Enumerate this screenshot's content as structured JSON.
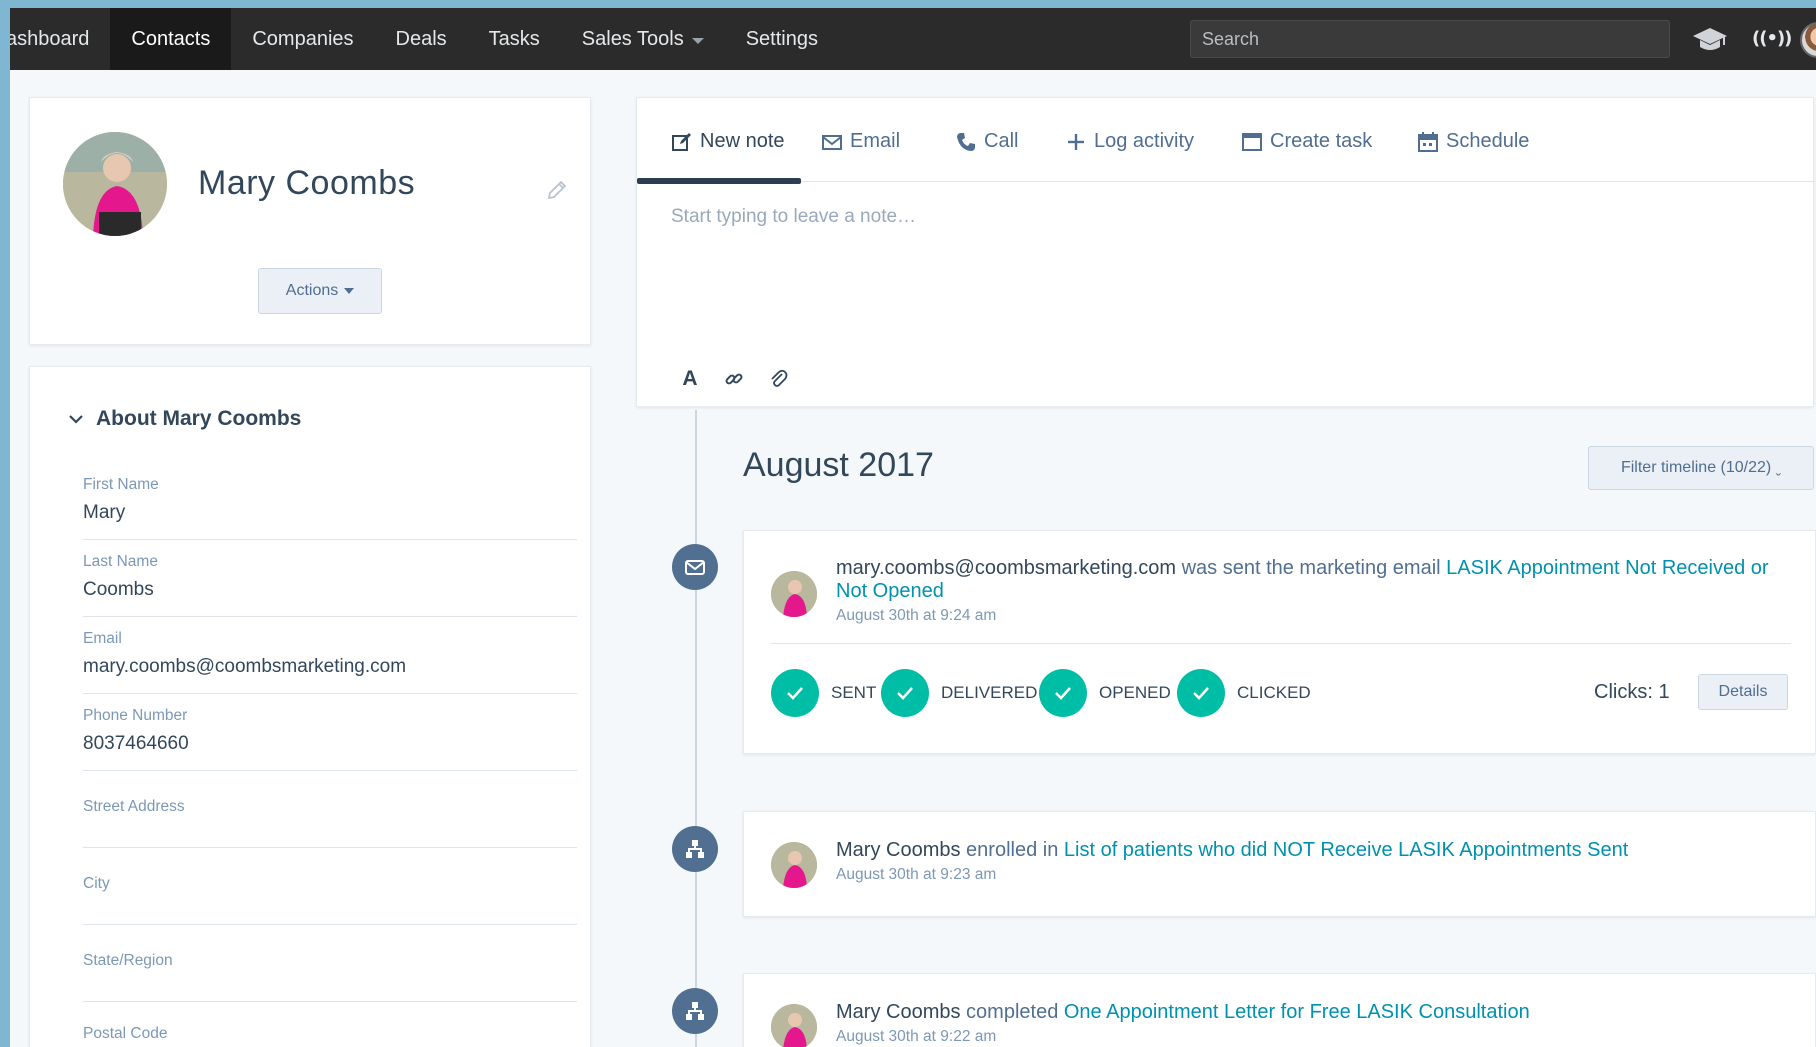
{
  "nav": {
    "items": [
      {
        "label": "ashboard",
        "active": false
      },
      {
        "label": "Contacts",
        "active": true
      },
      {
        "label": "Companies",
        "active": false
      },
      {
        "label": "Deals",
        "active": false
      },
      {
        "label": "Tasks",
        "active": false
      },
      {
        "label": "Sales Tools",
        "active": false,
        "dropdown": true
      },
      {
        "label": "Settings",
        "active": false
      }
    ],
    "search_placeholder": "Search",
    "icons": [
      "graduation-cap-icon",
      "broadcast-icon",
      "user-avatar"
    ],
    "broadcast_glyph": "((•))"
  },
  "profile": {
    "name": "Mary Coombs",
    "actions_label": "Actions"
  },
  "about": {
    "title": "About Mary Coombs",
    "fields": [
      {
        "label": "First Name",
        "value": "Mary"
      },
      {
        "label": "Last Name",
        "value": "Coombs"
      },
      {
        "label": "Email",
        "value": "mary.coombs@coombsmarketing.com"
      },
      {
        "label": "Phone Number",
        "value": "8037464660"
      },
      {
        "label": "Street Address",
        "value": ""
      },
      {
        "label": "City",
        "value": ""
      },
      {
        "label": "State/Region",
        "value": ""
      },
      {
        "label": "Postal Code",
        "value": ""
      }
    ]
  },
  "composer": {
    "tabs": [
      "New note",
      "Email",
      "Call",
      "Log activity",
      "Create task",
      "Schedule"
    ],
    "active_tab": "New note",
    "note_placeholder": "Start typing to leave a note…",
    "format_text_glyph": "A"
  },
  "timeline": {
    "month": "August 2017",
    "filter_label": "Filter timeline (10/22) ˬ",
    "events": [
      {
        "type": "email",
        "subject": "mary.coombs@coombsmarketing.com",
        "verb": " was sent the marketing email ",
        "link": "LASIK Appointment Not Received or Not Opened",
        "time": "August 30th at 9:24 am",
        "statuses": [
          "SENT",
          "DELIVERED",
          "OPENED",
          "CLICKED"
        ],
        "clicks_label": "Clicks: 1",
        "details_label": "Details"
      },
      {
        "type": "workflow",
        "subject": "Mary Coombs",
        "verb": " enrolled in ",
        "link": "List of patients who did NOT Receive LASIK Appointments Sent",
        "time": "August 30th at 9:23 am"
      },
      {
        "type": "workflow",
        "subject": "Mary Coombs",
        "verb": " completed ",
        "link": "One Appointment Letter for Free LASIK Consultation",
        "time": "August 30th at 9:22 am"
      }
    ]
  },
  "colors": {
    "nav_bg": "#2b2b2b",
    "accent_teal": "#00bda5",
    "link": "#0091ae",
    "timeline_icon": "#516f90",
    "border_blue": "#7fb7d3"
  }
}
